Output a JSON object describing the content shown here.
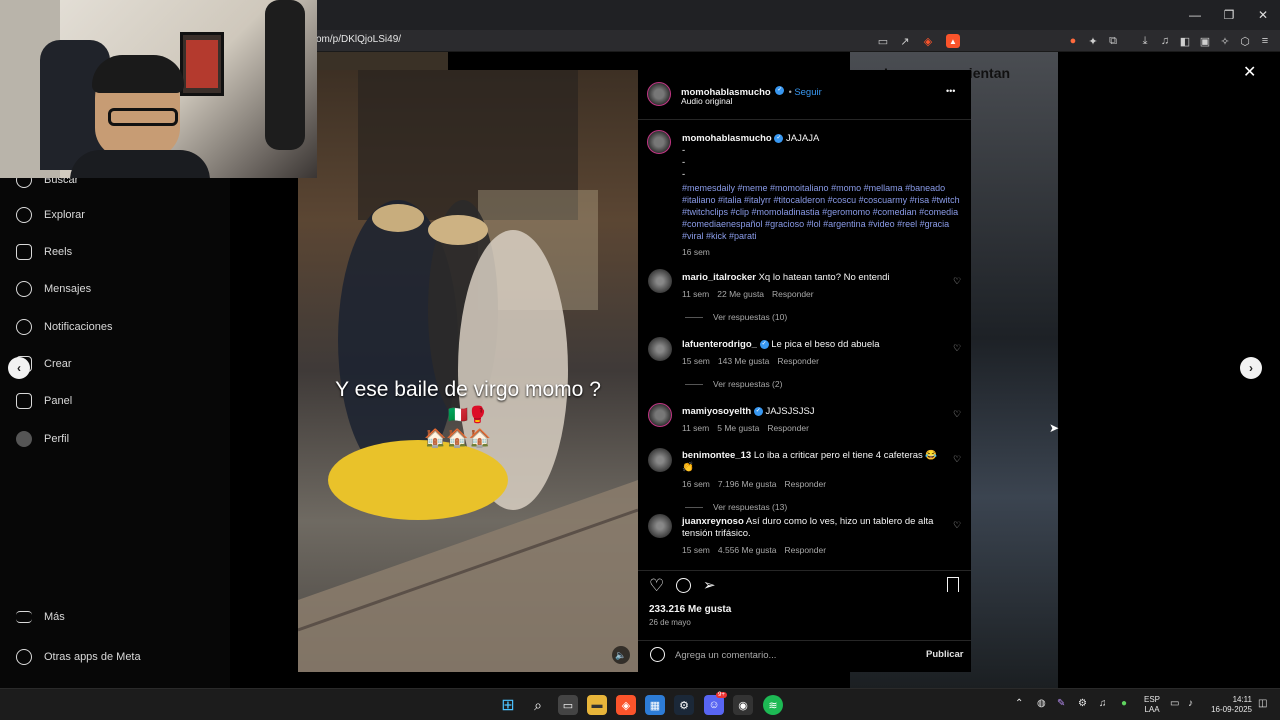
{
  "browser": {
    "url": "om/p/DKlQjoLSi49/",
    "window_controls": {
      "minimize": "—",
      "maximize": "❐",
      "close": "✕"
    }
  },
  "sidebar": {
    "items": [
      {
        "label": "Buscar",
        "icon": "search-icon"
      },
      {
        "label": "Explorar",
        "icon": "compass-icon"
      },
      {
        "label": "Reels",
        "icon": "reels-icon"
      },
      {
        "label": "Mensajes",
        "icon": "messenger-icon"
      },
      {
        "label": "Notificaciones",
        "icon": "heart-icon"
      },
      {
        "label": "Crear",
        "icon": "plus-icon"
      },
      {
        "label": "Panel",
        "icon": "chart-icon"
      },
      {
        "label": "Perfil",
        "icon": "avatar-icon"
      }
    ],
    "bottom": [
      {
        "label": "Más",
        "icon": "menu-icon"
      },
      {
        "label": "Otras apps de Meta",
        "icon": "meta-icon"
      }
    ]
  },
  "background": {
    "right_thumb_text": "Los que se sientan del ... vo:"
  },
  "video": {
    "overlay_text": "Y ese baile de virgo momo ?",
    "overlay_emoji": "🇮🇹🥊",
    "overlay_emoji2": "🏠🏠🏠",
    "mute_icon": "🔈"
  },
  "post": {
    "author": "momohablasmucho",
    "follow": "Seguir",
    "audio": "Audio original",
    "more": "•••",
    "caption_author": "momohablasmucho",
    "caption": "JAJAJA",
    "caption_lines": [
      "-",
      "-",
      "-"
    ],
    "hashtags": "#memesdaily #meme #momoitaliano #momo #mellama #baneado #italiano #italia #italyrr #titocalderon #coscu #coscuarmy #risa #twitch #twitchclips #clip #momoladinastia #geromomo #comedian #comedia #comediaenespañol #gracioso #lol #argentina #video #reel #gracia #viral #kick #parati",
    "caption_time": "16 sem",
    "likes": "233.216 Me gusta",
    "date": "26 de mayo",
    "comment_placeholder": "Agrega un comentario...",
    "publish": "Publicar"
  },
  "comments": [
    {
      "user": "mario_italrocker",
      "verified": false,
      "text": "Xq lo hatean tanto? No entendi",
      "time": "11 sem",
      "likes": "22 Me gusta",
      "reply": "Responder",
      "replies": "Ver respuestas (10)"
    },
    {
      "user": "lafuenterodrigo_",
      "verified": true,
      "text": "Le pica el beso dd abuela",
      "time": "15 sem",
      "likes": "143 Me gusta",
      "reply": "Responder",
      "replies": "Ver respuestas (2)"
    },
    {
      "user": "mamiyosoyelth",
      "verified": true,
      "text": "JAJSJSJSJ",
      "time": "11 sem",
      "likes": "5 Me gusta",
      "reply": "Responder",
      "replies": ""
    },
    {
      "user": "benimontee_13",
      "verified": false,
      "text": "Lo iba a criticar pero el tiene 4 cafeteras 😂👏",
      "time": "16 sem",
      "likes": "7.196 Me gusta",
      "reply": "Responder",
      "replies": "Ver respuestas (13)"
    },
    {
      "user": "juanxreynoso",
      "verified": false,
      "text": "Así duro como lo ves, hizo un tablero de alta tensión trifásico.",
      "time": "15 sem",
      "likes": "4.556 Me gusta",
      "reply": "Responder",
      "replies": ""
    }
  ],
  "taskbar": {
    "lang_top": "ESP",
    "lang_bottom": "LAA",
    "time": "14:11",
    "date": "16-09-2025",
    "discord_badge": "9+"
  },
  "colors": {
    "accent": "#3897f0",
    "hashtag": "#8a9be8",
    "background": "#000000"
  }
}
